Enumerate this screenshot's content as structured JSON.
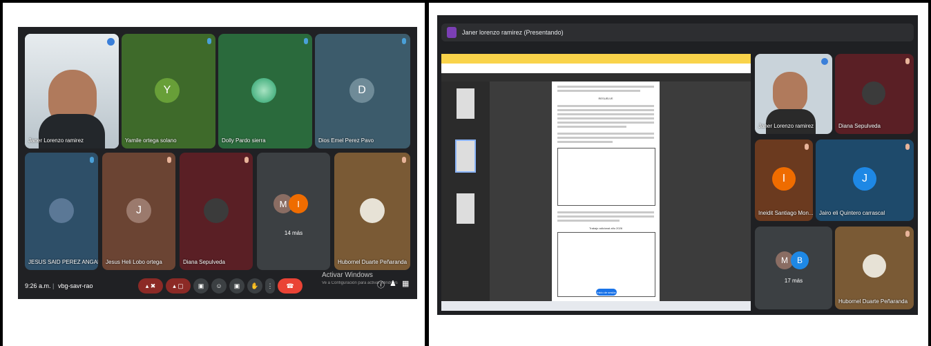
{
  "left": {
    "tiles": [
      {
        "name": "Janer Lorenzo ramirez",
        "initial": ""
      },
      {
        "name": "Yamile ortega solano",
        "initial": "Y"
      },
      {
        "name": "Dolly Pardo sierra",
        "initial": ""
      },
      {
        "name": "Dios Emel Perez Pavo",
        "initial": "D"
      },
      {
        "name": "JESUS SAID PEREZ ANGARITA",
        "initial": ""
      },
      {
        "name": "Jesus Heli Lobo ortega",
        "initial": "J"
      },
      {
        "name": "Diana Sepulveda",
        "initial": ""
      },
      {
        "name": "14 más",
        "initial": ""
      },
      {
        "name": "Hubornel Duarte Peñaranda",
        "initial": ""
      }
    ],
    "more_avatars": [
      "M",
      "I"
    ],
    "bottom": {
      "time": "9:26 a.m.",
      "separator": "|",
      "code": "vbg-savr-rao"
    },
    "activate": {
      "line1": "Activar Windows",
      "line2": "Ve a Configuración para activar Windows."
    }
  },
  "right": {
    "presenter_banner": "Janer lorenzo ramirez (Presentando)",
    "doc_heading": "RESUELVE",
    "button_label": "Inicio de sesión",
    "table_heading": "Trabajo adicional año 2026",
    "tiles": [
      {
        "name": "Janer Lorenzo ramirez",
        "initial": ""
      },
      {
        "name": "Diana Sepulveda",
        "initial": ""
      },
      {
        "name": "Ineidit Santiago Mon...",
        "initial": "I"
      },
      {
        "name": "Jairo eli Quintero carrascal",
        "initial": "J"
      },
      {
        "name": "17 más",
        "initial": ""
      },
      {
        "name": "Hubornel Duarte Peñaranda",
        "initial": ""
      }
    ],
    "more_avatars": [
      "M",
      "B"
    ]
  },
  "colors": {
    "red": "#ea4335",
    "meet_bg": "#202124"
  }
}
